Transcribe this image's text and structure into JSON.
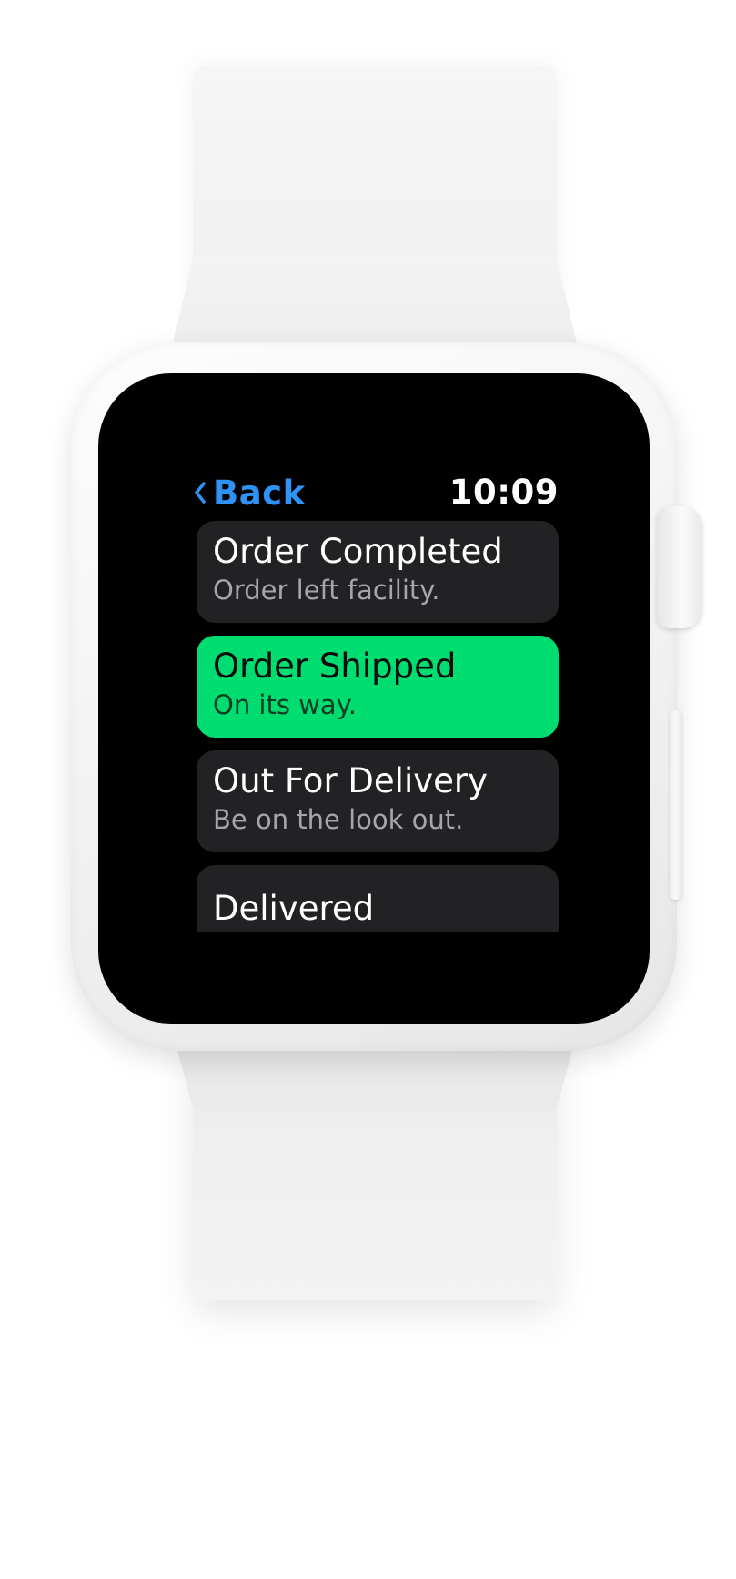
{
  "nav": {
    "back_label": "Back",
    "time": "10:09"
  },
  "colors": {
    "accent_blue": "#2f92f5",
    "active_green": "#00dd70",
    "row_background": "#222224",
    "subtitle_gray": "#a5a5ab"
  },
  "timeline": {
    "items": [
      {
        "title": "Order Completed",
        "subtitle": "Order left facility.",
        "active": false
      },
      {
        "title": "Order Shipped",
        "subtitle": "On its way.",
        "active": true
      },
      {
        "title": "Out For Delivery",
        "subtitle": "Be on the look out.",
        "active": false
      },
      {
        "title": "Delivered",
        "subtitle": "",
        "active": false
      }
    ]
  }
}
